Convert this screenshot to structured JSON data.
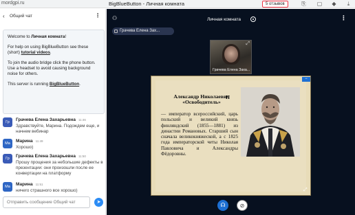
{
  "browser": {
    "url": "mordgpi.ru",
    "title": "BigBlueButton - Личная комната",
    "reviews": "5 отзывов"
  },
  "chat": {
    "header_label": "Общий чат",
    "welcome": {
      "line1_prefix": "Welcome to ",
      "line1_bold": "Личная комната",
      "line1_suffix": "!",
      "p2_prefix": "For help on using BigBlueButton see these (short) ",
      "p2_link": "tutorial videos",
      "p2_suffix": ".",
      "p3": "To join the audio bridge click the phone button. Use a headset to avoid causing background noise for others.",
      "p4_prefix": "This server is running ",
      "p4_link": "BigBlueButton",
      "p4_suffix": "."
    },
    "messages": [
      {
        "avatar": "Гр",
        "name": "Грачева Елена Захарьевна",
        "time": "11:46",
        "text": "Здравствуйте, Марина. Подождем еще, и начнем вебинар"
      },
      {
        "avatar": "Ма",
        "name": "Марина",
        "time": "11:49",
        "text": "Хорошо)"
      },
      {
        "avatar": "Гр",
        "name": "Грачева Елена Захарьевна",
        "time": "11:50",
        "text": "Прошу прощения за небольшие дефекты в презентации: они произошли после ее конвертации на платформу"
      },
      {
        "avatar": "Ма",
        "name": "Марина",
        "time": "11:51",
        "text": "ничего страшного все хорошо)"
      }
    ],
    "input_placeholder": "Отправить сообщение Общий чат"
  },
  "main": {
    "room_title": "Личная комната",
    "talker": "Грачева Елена Зах...",
    "webcam_name": "Грачева Елена Заха...",
    "slide": {
      "title": "Александр Николаевич «Освободитель»",
      "title_suffix": "II",
      "body": "— император всероссийский, царь польский и великий князь финляндский (1855—1881) из династии Романовых. Старший сын сначала великокняжеской, а с 1825 года императорской четы Николая Павловича и Александры Фёдоровны."
    }
  },
  "colors": {
    "accent": "#1d6fd3",
    "send": "#2c8cf4",
    "main_bg": "#07101f"
  }
}
